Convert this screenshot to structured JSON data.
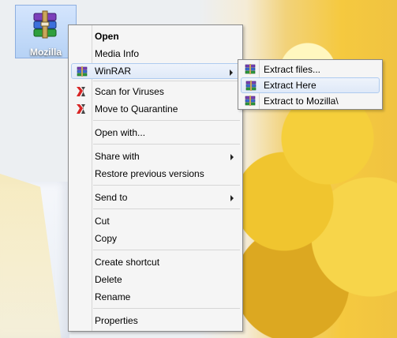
{
  "desktop": {
    "icon_label": "Mozilla"
  },
  "menu": {
    "items": [
      {
        "label": "Open"
      },
      {
        "label": "Media Info"
      },
      {
        "label": "WinRAR"
      },
      {
        "label": "Scan for Viruses"
      },
      {
        "label": "Move to Quarantine"
      },
      {
        "label": "Open with..."
      },
      {
        "label": "Share with"
      },
      {
        "label": "Restore previous versions"
      },
      {
        "label": "Send to"
      },
      {
        "label": "Cut"
      },
      {
        "label": "Copy"
      },
      {
        "label": "Create shortcut"
      },
      {
        "label": "Delete"
      },
      {
        "label": "Rename"
      },
      {
        "label": "Properties"
      }
    ]
  },
  "submenu": {
    "items": [
      {
        "label": "Extract files..."
      },
      {
        "label": "Extract Here"
      },
      {
        "label": "Extract to Mozilla\\"
      }
    ]
  },
  "icons": {
    "winrar": "winrar-icon",
    "scan": "kaspersky-icon",
    "quarantine": "kaspersky-icon",
    "submenu_arrow": "chevron-right-icon"
  },
  "colors": {
    "menu_bg": "#f5f5f5",
    "menu_border": "#8a8a8a",
    "highlight_bg": "#dfe9f8",
    "highlight_border": "#aecbef",
    "desktop_selection": "#a7caf6"
  }
}
